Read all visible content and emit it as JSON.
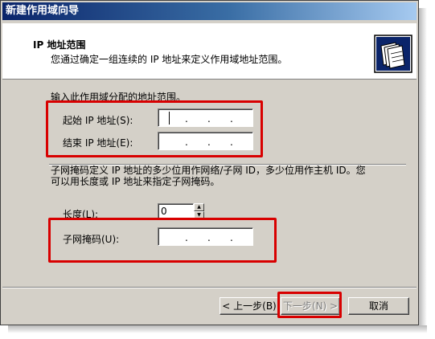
{
  "window": {
    "title": "新建作用域向导"
  },
  "header": {
    "title": "IP 地址范围",
    "subtitle": "您通过确定一组连续的 IP 地址来定义作用域地址范围。",
    "icon": "folder-wizard-icon"
  },
  "range": {
    "group_label": "输入此作用域分配的地址范围。",
    "start_label": "起始 IP 地址(S):",
    "end_label": "结束 IP 地址(E):",
    "start_value": "",
    "end_value": ""
  },
  "mask": {
    "description_line1": "子网掩码定义 IP 地址的多少位用作网络/子网 ID，多少位用作主机 ID。您",
    "description_line2": "可以用长度或 IP 地址来指定子网掩码。",
    "length_label": "长度(L):",
    "length_value": "0",
    "mask_label": "子网掩码(U):",
    "mask_value": ""
  },
  "buttons": {
    "back": "< 上一步(B)",
    "next": "下一步(N) >",
    "cancel": "取消"
  },
  "colors": {
    "highlight_box": "#d80000",
    "dialog_bg": "#d4d0c8",
    "title_gradient_start": "#0a246a"
  }
}
